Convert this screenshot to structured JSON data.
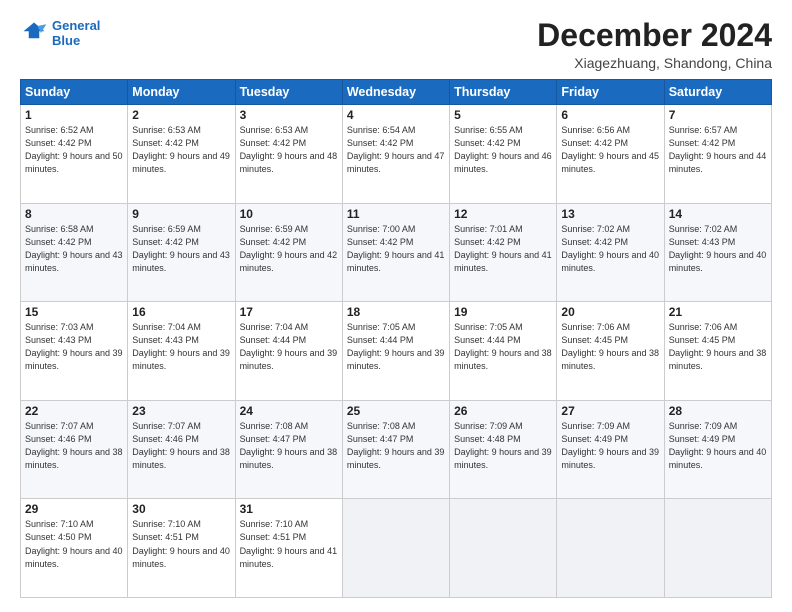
{
  "logo": {
    "line1": "General",
    "line2": "Blue"
  },
  "title": "December 2024",
  "location": "Xiagezhuang, Shandong, China",
  "days_of_week": [
    "Sunday",
    "Monday",
    "Tuesday",
    "Wednesday",
    "Thursday",
    "Friday",
    "Saturday"
  ],
  "weeks": [
    [
      {
        "day": "1",
        "rise": "6:52 AM",
        "set": "4:42 PM",
        "daylight": "9 hours and 50 minutes."
      },
      {
        "day": "2",
        "rise": "6:53 AM",
        "set": "4:42 PM",
        "daylight": "9 hours and 49 minutes."
      },
      {
        "day": "3",
        "rise": "6:53 AM",
        "set": "4:42 PM",
        "daylight": "9 hours and 48 minutes."
      },
      {
        "day": "4",
        "rise": "6:54 AM",
        "set": "4:42 PM",
        "daylight": "9 hours and 47 minutes."
      },
      {
        "day": "5",
        "rise": "6:55 AM",
        "set": "4:42 PM",
        "daylight": "9 hours and 46 minutes."
      },
      {
        "day": "6",
        "rise": "6:56 AM",
        "set": "4:42 PM",
        "daylight": "9 hours and 45 minutes."
      },
      {
        "day": "7",
        "rise": "6:57 AM",
        "set": "4:42 PM",
        "daylight": "9 hours and 44 minutes."
      }
    ],
    [
      {
        "day": "8",
        "rise": "6:58 AM",
        "set": "4:42 PM",
        "daylight": "9 hours and 43 minutes."
      },
      {
        "day": "9",
        "rise": "6:59 AM",
        "set": "4:42 PM",
        "daylight": "9 hours and 43 minutes."
      },
      {
        "day": "10",
        "rise": "6:59 AM",
        "set": "4:42 PM",
        "daylight": "9 hours and 42 minutes."
      },
      {
        "day": "11",
        "rise": "7:00 AM",
        "set": "4:42 PM",
        "daylight": "9 hours and 41 minutes."
      },
      {
        "day": "12",
        "rise": "7:01 AM",
        "set": "4:42 PM",
        "daylight": "9 hours and 41 minutes."
      },
      {
        "day": "13",
        "rise": "7:02 AM",
        "set": "4:42 PM",
        "daylight": "9 hours and 40 minutes."
      },
      {
        "day": "14",
        "rise": "7:02 AM",
        "set": "4:43 PM",
        "daylight": "9 hours and 40 minutes."
      }
    ],
    [
      {
        "day": "15",
        "rise": "7:03 AM",
        "set": "4:43 PM",
        "daylight": "9 hours and 39 minutes."
      },
      {
        "day": "16",
        "rise": "7:04 AM",
        "set": "4:43 PM",
        "daylight": "9 hours and 39 minutes."
      },
      {
        "day": "17",
        "rise": "7:04 AM",
        "set": "4:44 PM",
        "daylight": "9 hours and 39 minutes."
      },
      {
        "day": "18",
        "rise": "7:05 AM",
        "set": "4:44 PM",
        "daylight": "9 hours and 39 minutes."
      },
      {
        "day": "19",
        "rise": "7:05 AM",
        "set": "4:44 PM",
        "daylight": "9 hours and 38 minutes."
      },
      {
        "day": "20",
        "rise": "7:06 AM",
        "set": "4:45 PM",
        "daylight": "9 hours and 38 minutes."
      },
      {
        "day": "21",
        "rise": "7:06 AM",
        "set": "4:45 PM",
        "daylight": "9 hours and 38 minutes."
      }
    ],
    [
      {
        "day": "22",
        "rise": "7:07 AM",
        "set": "4:46 PM",
        "daylight": "9 hours and 38 minutes."
      },
      {
        "day": "23",
        "rise": "7:07 AM",
        "set": "4:46 PM",
        "daylight": "9 hours and 38 minutes."
      },
      {
        "day": "24",
        "rise": "7:08 AM",
        "set": "4:47 PM",
        "daylight": "9 hours and 38 minutes."
      },
      {
        "day": "25",
        "rise": "7:08 AM",
        "set": "4:47 PM",
        "daylight": "9 hours and 39 minutes."
      },
      {
        "day": "26",
        "rise": "7:09 AM",
        "set": "4:48 PM",
        "daylight": "9 hours and 39 minutes."
      },
      {
        "day": "27",
        "rise": "7:09 AM",
        "set": "4:49 PM",
        "daylight": "9 hours and 39 minutes."
      },
      {
        "day": "28",
        "rise": "7:09 AM",
        "set": "4:49 PM",
        "daylight": "9 hours and 40 minutes."
      }
    ],
    [
      {
        "day": "29",
        "rise": "7:10 AM",
        "set": "4:50 PM",
        "daylight": "9 hours and 40 minutes."
      },
      {
        "day": "30",
        "rise": "7:10 AM",
        "set": "4:51 PM",
        "daylight": "9 hours and 40 minutes."
      },
      {
        "day": "31",
        "rise": "7:10 AM",
        "set": "4:51 PM",
        "daylight": "9 hours and 41 minutes."
      },
      null,
      null,
      null,
      null
    ]
  ]
}
